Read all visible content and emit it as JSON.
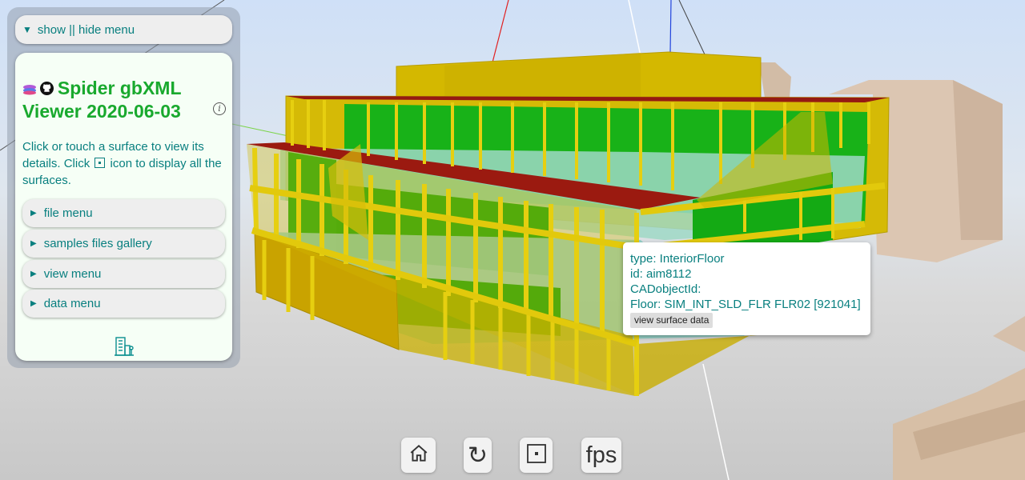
{
  "menu": {
    "toggle_label": "show || hide menu",
    "title": "Spider gbXML Viewer 2020-06-03",
    "description_before": "Click or touch a surface to view its details. Click ",
    "description_after": " icon to display all the surfaces.",
    "sections": [
      {
        "label": "file menu"
      },
      {
        "label": "samples files gallery"
      },
      {
        "label": "view menu"
      },
      {
        "label": "data menu"
      }
    ]
  },
  "popup": {
    "type_line": "type: InteriorFloor",
    "id_line": "id: aim8112",
    "cad_line": "CADobjectId:",
    "floor_line": "Floor: SIM_INT_SLD_FLR FLR02 [921041]",
    "button_label": "view surface data"
  },
  "toolbar": {
    "fps_label": "fps"
  },
  "colors": {
    "title_green": "#19a92e",
    "text_teal": "#087f7f",
    "wall_yellow": "#d9c200",
    "window_green": "#14b014",
    "roof_red": "#9b1a10",
    "floor_cyan": "#8fd6cc",
    "neighbor_tan": "#d8c2ad"
  }
}
